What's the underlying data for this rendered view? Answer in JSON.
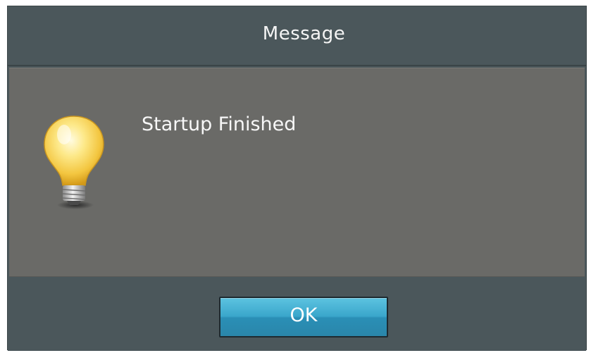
{
  "dialog": {
    "title": "Message",
    "message": "Startup Finished",
    "icon": "lightbulb-icon",
    "ok_label": "OK",
    "colors": {
      "frame": "#4b575b",
      "panel": "#6a6a67",
      "button": "#3aa6cb",
      "text": "#f7f7f7"
    }
  }
}
